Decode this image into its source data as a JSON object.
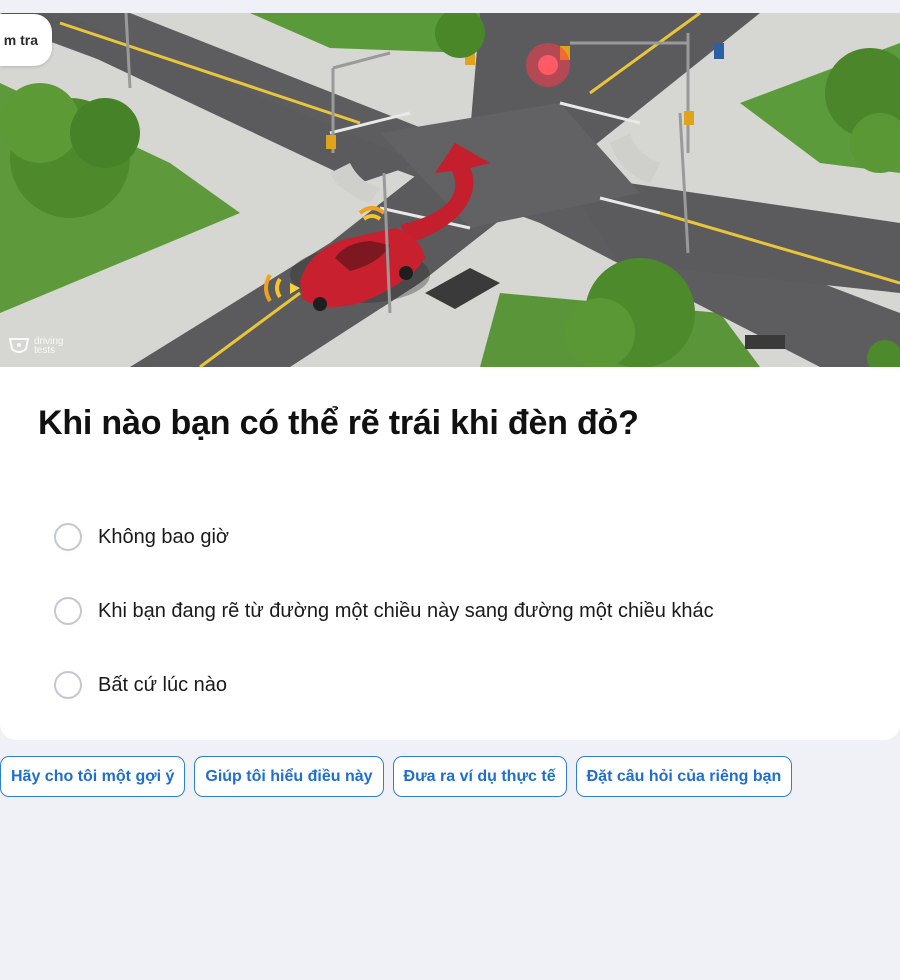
{
  "mode_tab": {
    "label": "m tra"
  },
  "scene": {
    "watermark_line1": "driving",
    "watermark_line2": "tests"
  },
  "question": {
    "text": "Khi nào bạn có thể rẽ trái khi đèn đỏ?"
  },
  "answers": [
    {
      "label": "Không bao giờ"
    },
    {
      "label": "Khi bạn đang rẽ từ đường một chiều này sang đường một chiều khác"
    },
    {
      "label": "Bất cứ lúc nào"
    }
  ],
  "actions": [
    {
      "label": "Hãy cho tôi một gợi ý"
    },
    {
      "label": "Giúp tôi hiểu điều này"
    },
    {
      "label": "Đưa ra ví dụ thực tế"
    },
    {
      "label": "Đặt câu hỏi của riêng bạn"
    }
  ],
  "colors": {
    "accent": "#2f7fd8",
    "background": "#f0f1f6",
    "car": "#c8202e"
  }
}
